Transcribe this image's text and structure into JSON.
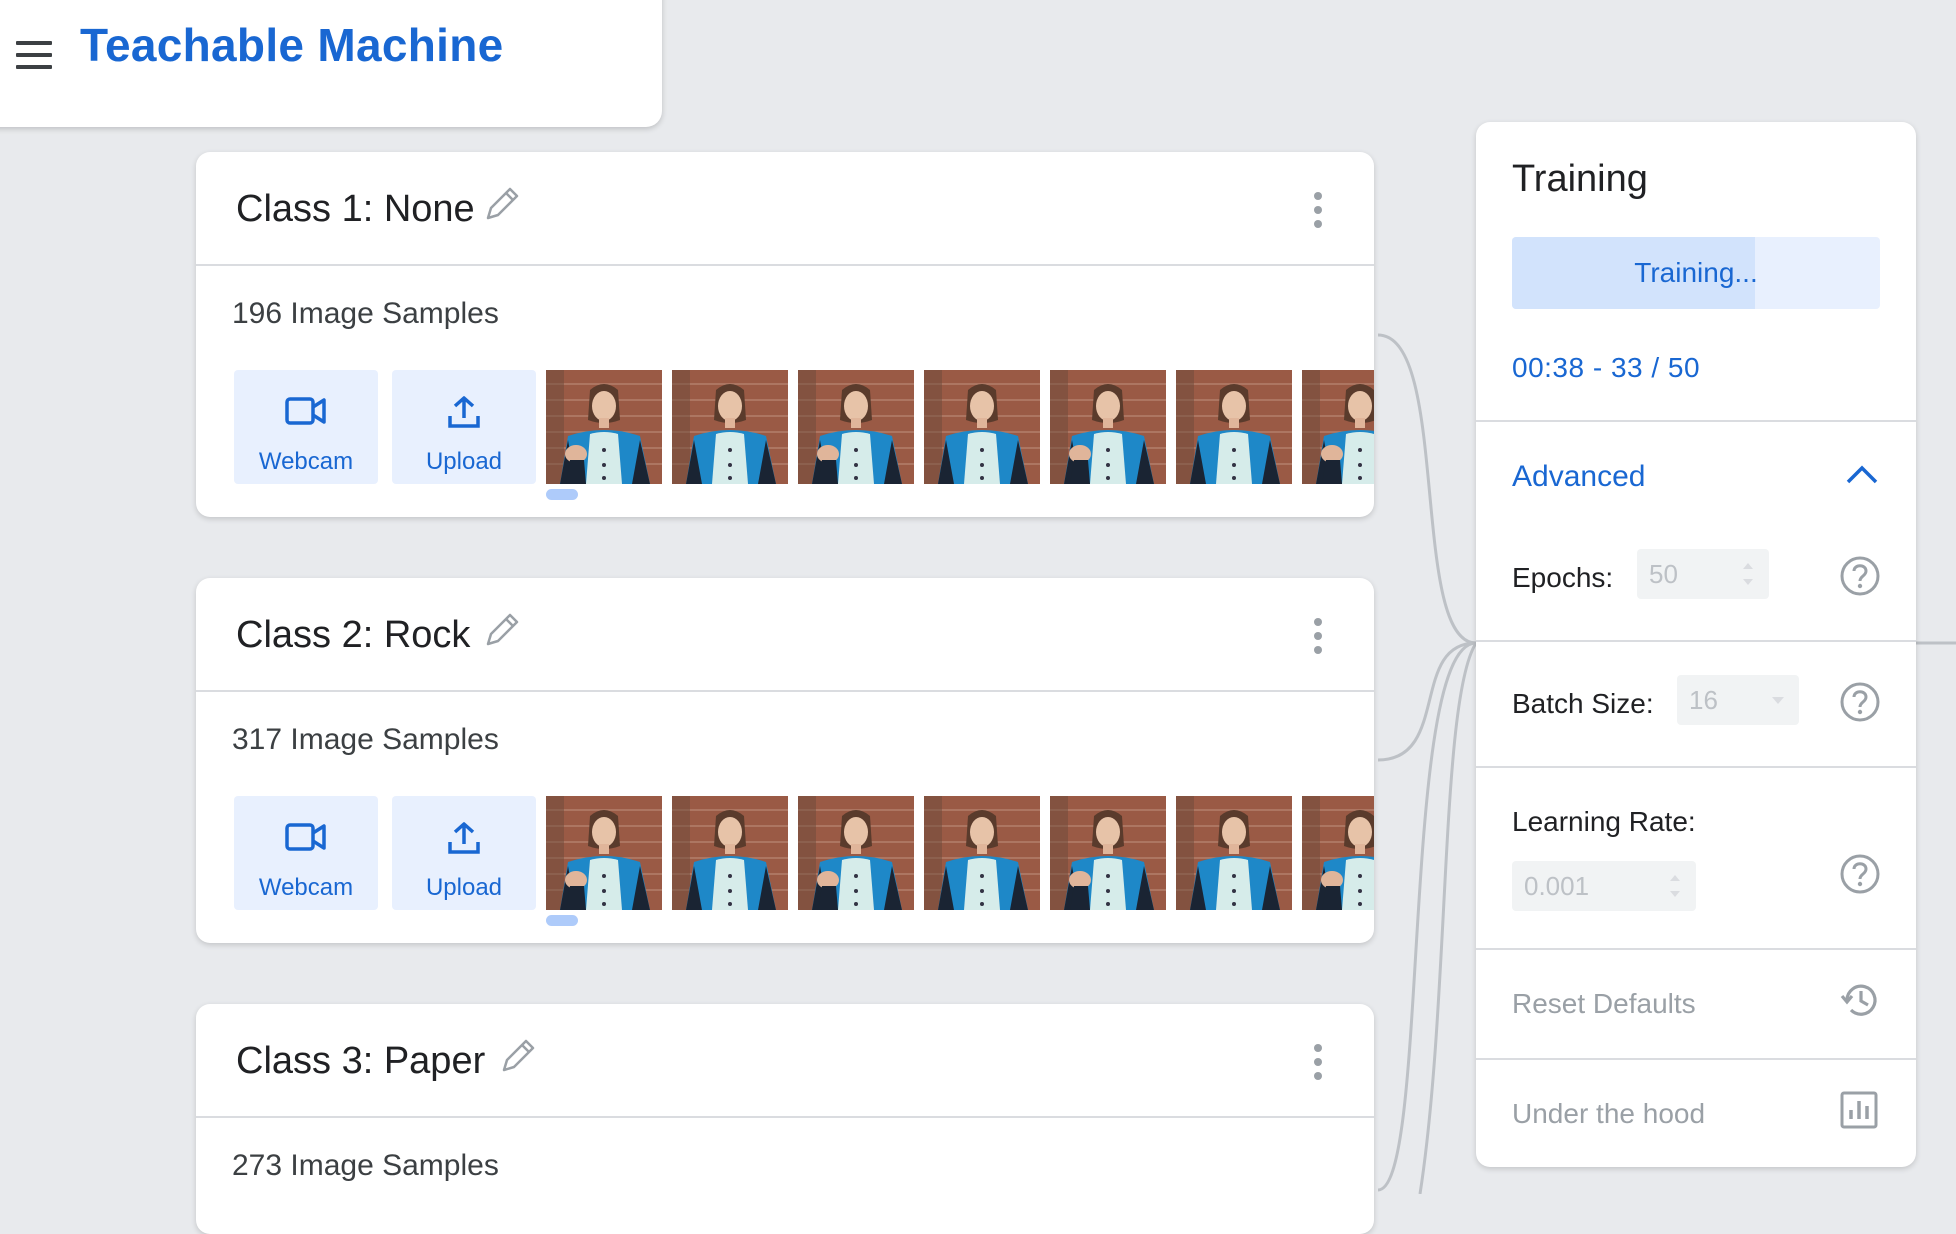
{
  "app": {
    "title": "Teachable Machine"
  },
  "classes": [
    {
      "name": "Class 1: None",
      "samples": "196 Image Samples",
      "webcam_label": "Webcam",
      "upload_label": "Upload",
      "thumbnail_count": 7
    },
    {
      "name": "Class 2: Rock",
      "samples": "317 Image Samples",
      "webcam_label": "Webcam",
      "upload_label": "Upload",
      "thumbnail_count": 7
    },
    {
      "name": "Class 3: Paper",
      "samples": "273 Image Samples"
    }
  ],
  "training": {
    "title": "Training",
    "button_label": "Training...",
    "progress_fraction": 0.66,
    "status": "00:38 - 33 / 50",
    "advanced_label": "Advanced",
    "epochs": {
      "label": "Epochs:",
      "value": "50"
    },
    "batch_size": {
      "label": "Batch Size:",
      "value": "16"
    },
    "learning_rate": {
      "label": "Learning Rate:",
      "value": "0.001"
    },
    "reset_label": "Reset Defaults",
    "under_hood_label": "Under the hood"
  },
  "colors": {
    "accent": "#1967d2",
    "tile_bg": "#e8f0fe",
    "background": "#e8eaed"
  },
  "icons": [
    "menu-icon",
    "pencil-icon",
    "more-vert-icon",
    "videocam-icon",
    "upload-icon",
    "chevron-up-icon",
    "help-icon",
    "history-icon",
    "bar-chart-icon"
  ]
}
